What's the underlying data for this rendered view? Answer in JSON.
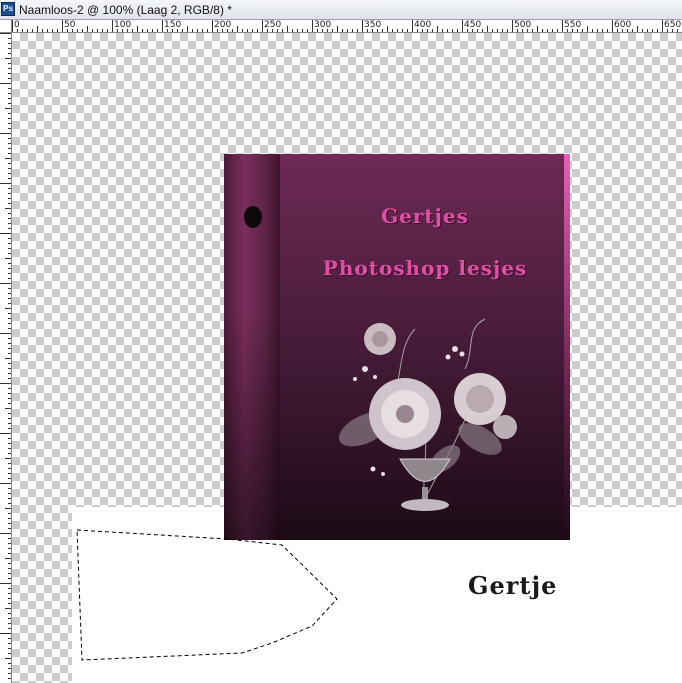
{
  "window": {
    "app_icon_label": "Ps",
    "title": "Naamloos-2 @ 100% (Laag 2, RGB/8) *"
  },
  "ruler": {
    "horizontal_labels": [
      "0",
      "50",
      "100",
      "150",
      "200",
      "250",
      "300",
      "350",
      "400",
      "450",
      "500",
      "550",
      "600",
      "650"
    ]
  },
  "artwork": {
    "cover_line_1": "Gertjes",
    "cover_line_2": "Photoshop lesjes",
    "signature": "Gertje"
  },
  "colors": {
    "cover_text": "#e04fa5",
    "binder_dark": "#1c0a16",
    "binder_mid": "#6d2a55"
  },
  "icons": {
    "app": "photoshop-icon",
    "selection": "marquee-selection-icon"
  }
}
